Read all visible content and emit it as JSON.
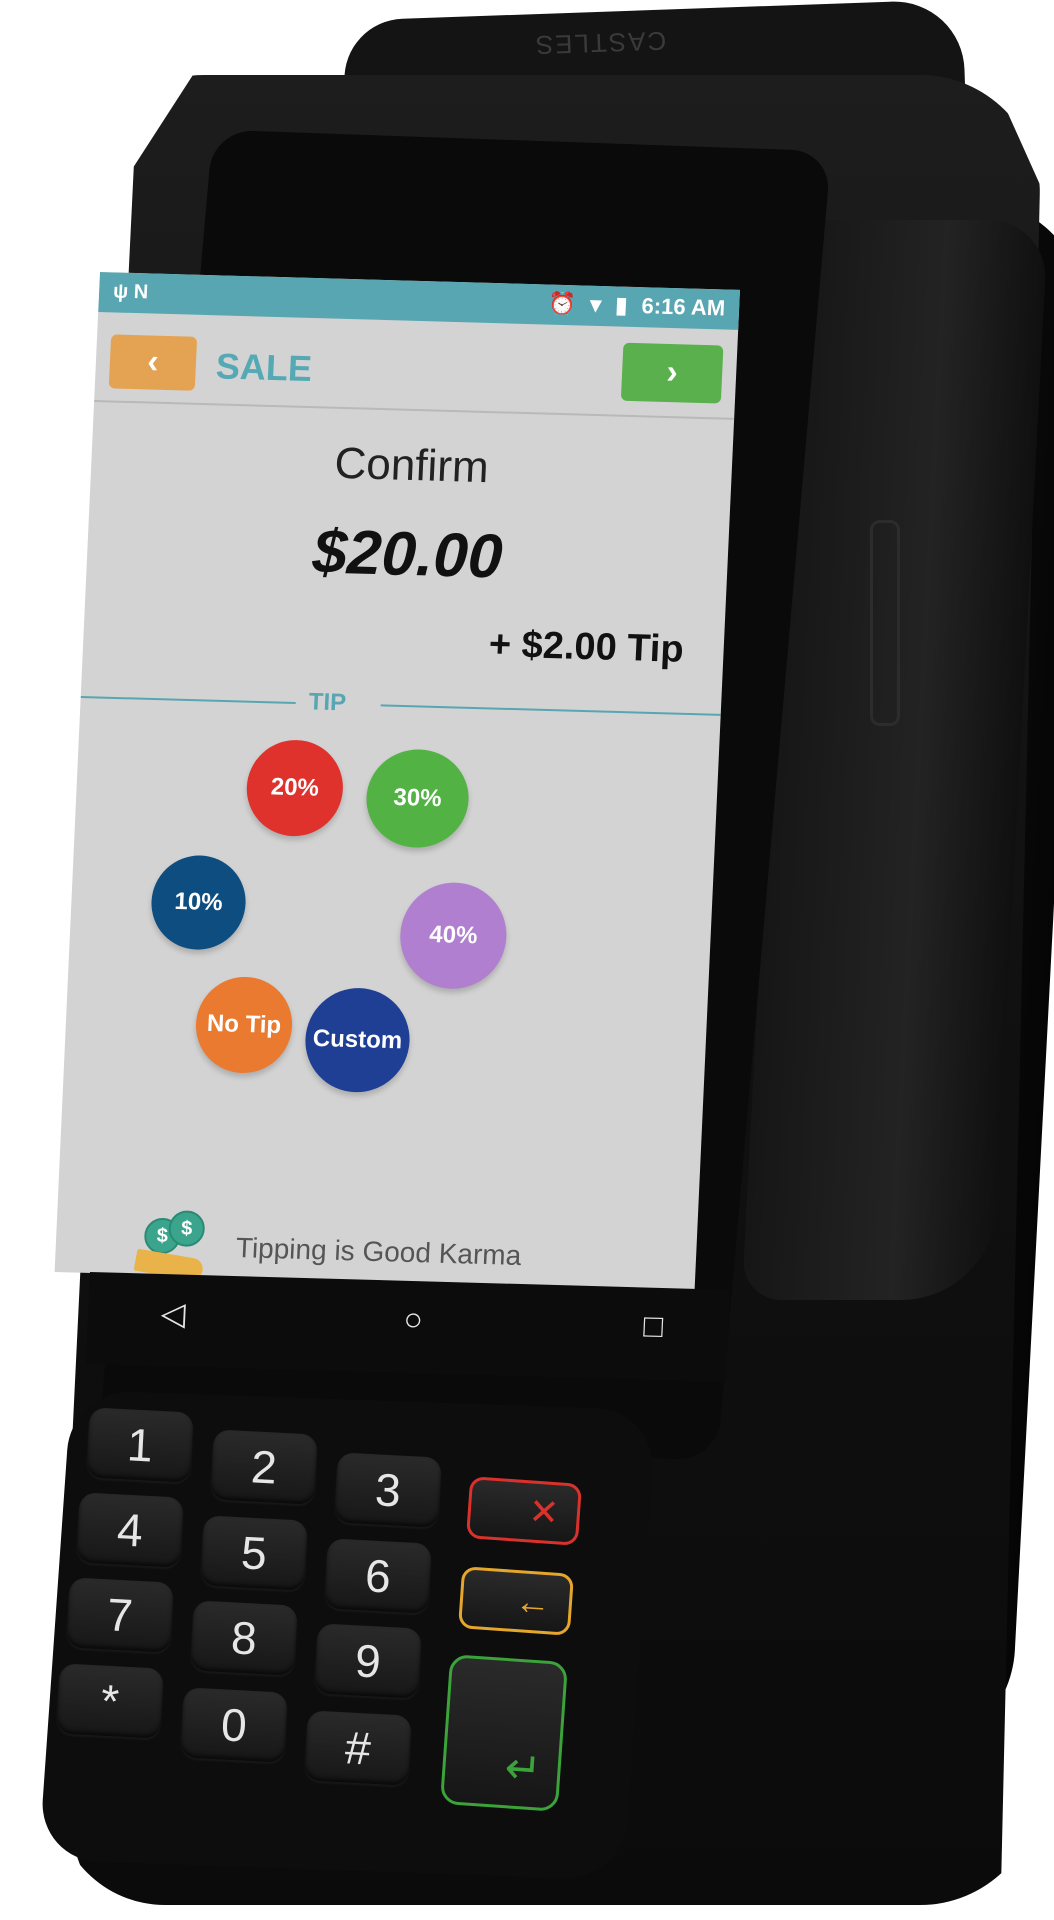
{
  "device": {
    "brand": "CASTLES"
  },
  "status_bar": {
    "left_icons": "ψ N",
    "alarm_icon": "⏰",
    "wifi_icon": "▾",
    "battery_icon": "▮",
    "time": "6:16 AM"
  },
  "header": {
    "back_label": "‹",
    "title": "SALE",
    "next_label": "›"
  },
  "confirm": {
    "heading": "Confirm",
    "amount": "$20.00",
    "tip_line": "+ $2.00 Tip"
  },
  "tip": {
    "section_label": "TIP",
    "options": [
      {
        "label": "20%",
        "color": "#e0322c"
      },
      {
        "label": "30%",
        "color": "#52b244"
      },
      {
        "label": "10%",
        "color": "#0e4d7f"
      },
      {
        "label": "40%",
        "color": "#b07fd0"
      },
      {
        "label": "No Tip",
        "color": "#e97a30"
      },
      {
        "label": "Custom",
        "color": "#1f3f95"
      }
    ]
  },
  "footer": {
    "karma_text": "Tipping is Good Karma",
    "coin_symbol": "$"
  },
  "nav": {
    "back": "◁",
    "home": "○",
    "recents": "□"
  },
  "keypad": {
    "keys": [
      "1",
      "2",
      "3",
      "4",
      "5",
      "6",
      "7",
      "8",
      "9",
      "*",
      "0",
      "#"
    ],
    "cancel": "✕",
    "clear": "←",
    "enter": "↵",
    "colors": {
      "cancel": "#d9322c",
      "clear": "#e5a62d",
      "enter": "#3ba33a"
    }
  }
}
